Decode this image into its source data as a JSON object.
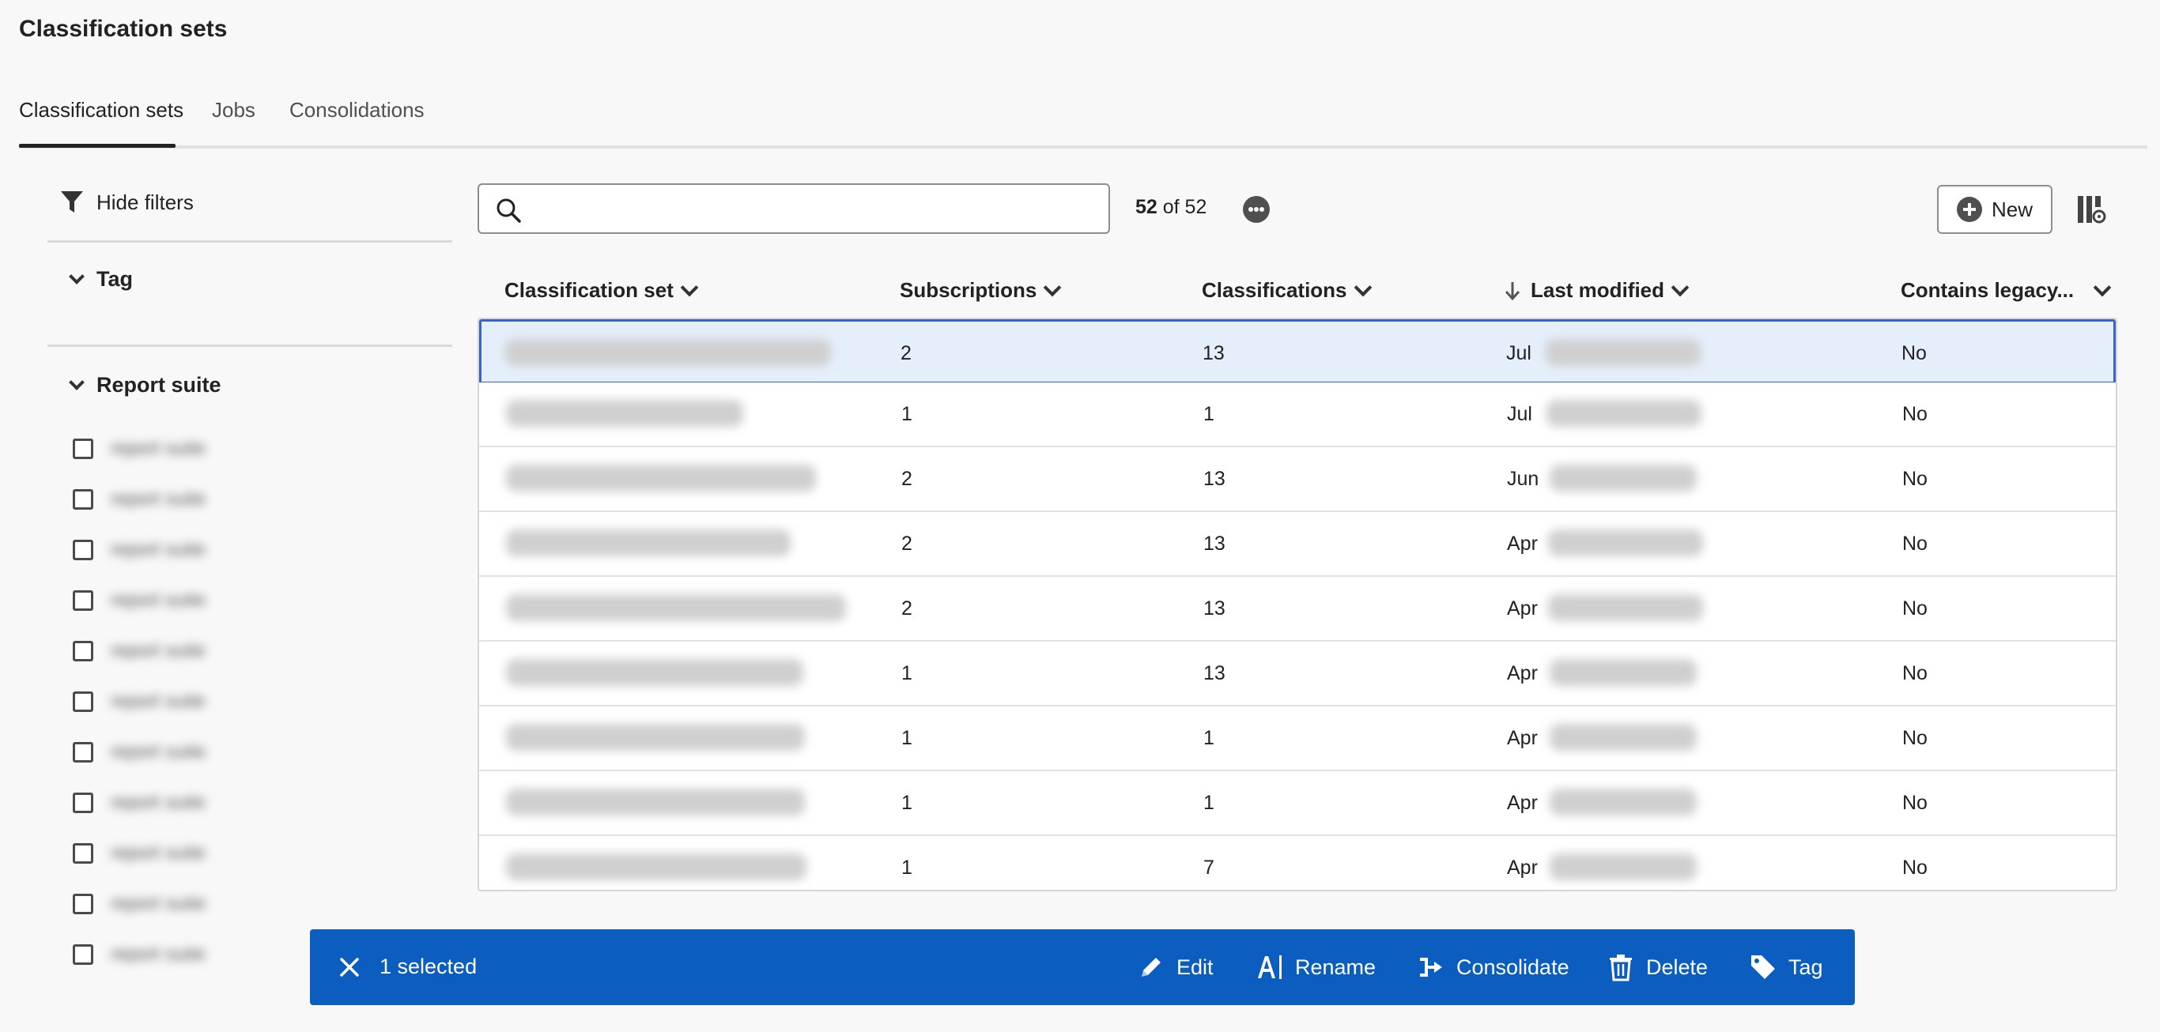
{
  "page": {
    "title": "Classification sets"
  },
  "tabs": [
    {
      "label": "Classification sets",
      "active": true
    },
    {
      "label": "Jobs",
      "active": false
    },
    {
      "label": "Consolidations",
      "active": false
    }
  ],
  "filters": {
    "toggle_label": "Hide filters",
    "facets": [
      {
        "label": "Tag",
        "expanded": true
      },
      {
        "label": "Report suite",
        "expanded": true
      }
    ],
    "report_suite_items": [
      "report suite",
      "report suite",
      "report suite",
      "report suite",
      "report suite",
      "report suite",
      "report suite",
      "report suite",
      "report suite",
      "report suite",
      "report suite"
    ]
  },
  "toolbar": {
    "search_placeholder": "",
    "count_shown": "52",
    "count_of": "of 52",
    "new_label": "New"
  },
  "table": {
    "columns": [
      "Classification set",
      "Subscriptions",
      "Classifications",
      "Last modified",
      "Contains legacy..."
    ],
    "sort_column": "Last modified",
    "sort_direction": "descending",
    "rows": [
      {
        "subscriptions": "2",
        "classifications": "13",
        "month": "Jul",
        "legacy": "No",
        "selected": true
      },
      {
        "subscriptions": "1",
        "classifications": "1",
        "month": "Jul",
        "legacy": "No",
        "selected": false
      },
      {
        "subscriptions": "2",
        "classifications": "13",
        "month": "Jun",
        "legacy": "No",
        "selected": false
      },
      {
        "subscriptions": "2",
        "classifications": "13",
        "month": "Apr",
        "legacy": "No",
        "selected": false
      },
      {
        "subscriptions": "2",
        "classifications": "13",
        "month": "Apr",
        "legacy": "No",
        "selected": false
      },
      {
        "subscriptions": "1",
        "classifications": "13",
        "month": "Apr",
        "legacy": "No",
        "selected": false
      },
      {
        "subscriptions": "1",
        "classifications": "1",
        "month": "Apr",
        "legacy": "No",
        "selected": false
      },
      {
        "subscriptions": "1",
        "classifications": "1",
        "month": "Apr",
        "legacy": "No",
        "selected": false
      },
      {
        "subscriptions": "1",
        "classifications": "7",
        "month": "Apr",
        "legacy": "No",
        "selected": false
      }
    ]
  },
  "action_bar": {
    "selected_label": "1 selected",
    "actions": [
      "Edit",
      "Rename",
      "Consolidate",
      "Delete",
      "Tag"
    ]
  },
  "icons": {
    "filter": "filter-icon",
    "search": "search-icon",
    "more": "more-icon",
    "add": "plus-circle-icon",
    "columns": "column-settings-icon",
    "sort": "arrow-down-icon",
    "close": "close-icon",
    "edit": "pencil-icon",
    "rename": "rename-icon",
    "consolidate": "consolidate-icon",
    "delete": "trash-icon",
    "tag": "tag-icon"
  },
  "colors": {
    "accent": "#0b5dc0",
    "selected_row": "#e5effb",
    "selected_border": "#3b63c7"
  }
}
